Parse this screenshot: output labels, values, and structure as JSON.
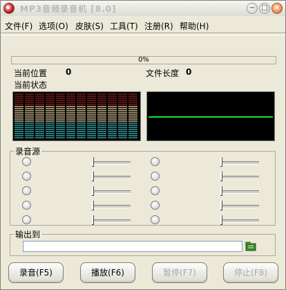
{
  "window": {
    "title": "MP3音频录音机 [8.0]",
    "controls": {
      "minimize": "−",
      "maximize": "□",
      "close": "×"
    }
  },
  "menu": [
    "文件(F)",
    "选项(O)",
    "皮肤(S)",
    "工具(T)",
    "注册(R)",
    "帮助(H)"
  ],
  "progress": {
    "value": 0,
    "text": "0%"
  },
  "info": {
    "position_label": "当前位置",
    "position_value": "0",
    "length_label": "文件长度",
    "length_value": "0",
    "state_label": "当前状态"
  },
  "source": {
    "legend": "录音源",
    "rows": 5,
    "columns": 2
  },
  "output": {
    "legend": "输出到",
    "path": "",
    "browse_icon": "folder-icon"
  },
  "buttons": {
    "record": "录音(F5)",
    "play": "播放(F6)",
    "pause": "暂停(F7)",
    "stop": "停止(F8)"
  },
  "colors": {
    "spectrum_top": "#7a1e1e",
    "spectrum_mid": "#c8b48c",
    "spectrum_low": "#3a9e9e",
    "wave": "#18e02e",
    "disabled_text": "#a8a8a8"
  }
}
